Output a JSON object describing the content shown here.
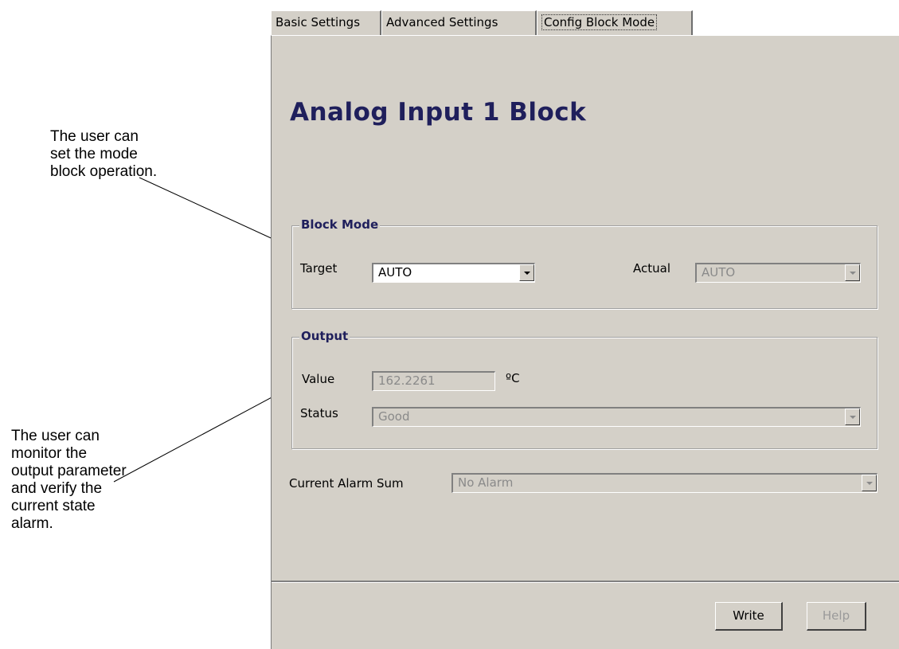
{
  "callouts": [
    "The user can set the mode block operation.",
    "The user can monitor the output parameter and verify the current state alarm."
  ],
  "tabs": [
    {
      "label": "Basic Settings"
    },
    {
      "label": "Advanced Settings"
    },
    {
      "label": "Config Block Mode"
    }
  ],
  "panel": {
    "title": "Analog Input 1 Block",
    "block_mode": {
      "legend": "Block Mode",
      "target_label": "Target",
      "target_value": "AUTO",
      "actual_label": "Actual",
      "actual_value": "AUTO"
    },
    "output": {
      "legend": "Output",
      "value_label": "Value",
      "value": "162.2261",
      "unit": "ºC",
      "status_label": "Status",
      "status_value": "Good"
    },
    "alarm": {
      "label": "Current  Alarm Sum",
      "value": "No Alarm"
    },
    "buttons": {
      "write": "Write",
      "help": "Help"
    }
  }
}
